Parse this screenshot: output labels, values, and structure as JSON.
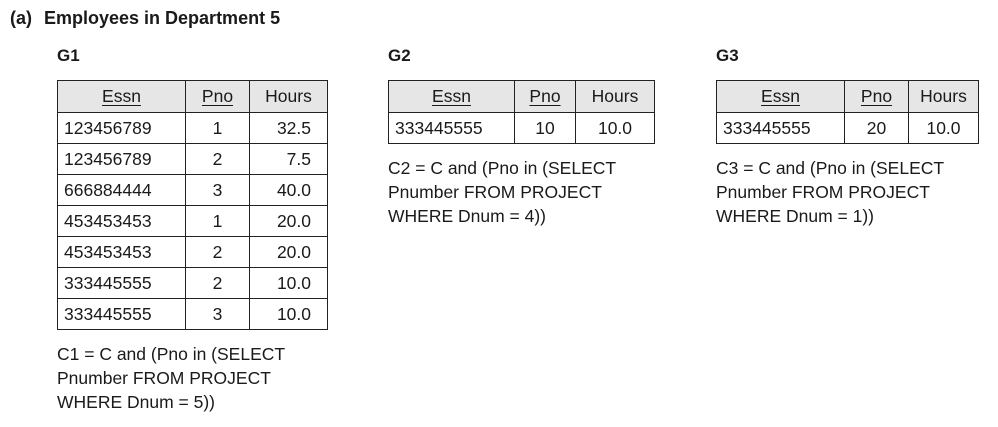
{
  "heading": {
    "label": "(a)",
    "title": "Employees in Department 5"
  },
  "groups": [
    {
      "name": "G1",
      "columns": [
        "Essn",
        "Pno",
        "Hours"
      ],
      "rows": [
        [
          "123456789",
          "1",
          "32.5"
        ],
        [
          "123456789",
          "2",
          "7.5"
        ],
        [
          "666884444",
          "3",
          "40.0"
        ],
        [
          "453453453",
          "1",
          "20.0"
        ],
        [
          "453453453",
          "2",
          "20.0"
        ],
        [
          "333445555",
          "2",
          "10.0"
        ],
        [
          "333445555",
          "3",
          "10.0"
        ]
      ],
      "condition": [
        "C1 = C and (Pno in (SELECT",
        "Pnumber FROM PROJECT",
        "WHERE Dnum = 5))"
      ]
    },
    {
      "name": "G2",
      "columns": [
        "Essn",
        "Pno",
        "Hours"
      ],
      "rows": [
        [
          "333445555",
          "10",
          "10.0"
        ]
      ],
      "condition": [
        "C2 = C and (Pno in (SELECT",
        "Pnumber FROM PROJECT",
        "WHERE Dnum = 4))"
      ]
    },
    {
      "name": "G3",
      "columns": [
        "Essn",
        "Pno",
        "Hours"
      ],
      "rows": [
        [
          "333445555",
          "20",
          "10.0"
        ]
      ],
      "condition": [
        "C3 = C and (Pno in (SELECT",
        "Pnumber FROM PROJECT",
        "WHERE Dnum = 1))"
      ]
    }
  ]
}
